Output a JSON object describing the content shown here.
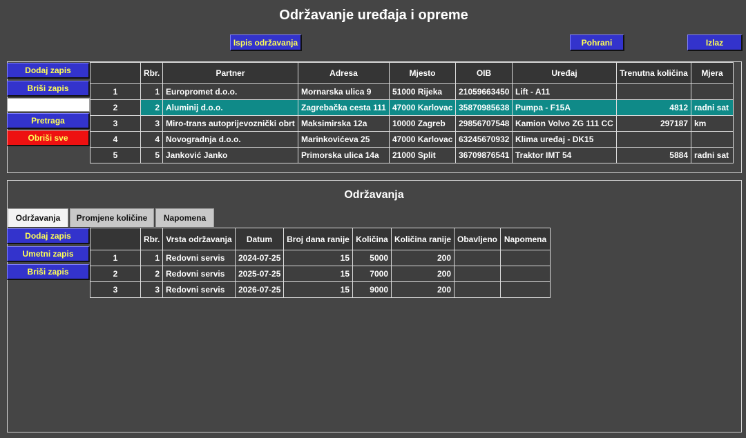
{
  "app": {
    "title": "Održavanje uređaja i opreme"
  },
  "toolbar": {
    "print_label": "Ispis održavanja",
    "save_label": "Pohrani",
    "exit_label": "Izlaz"
  },
  "devices": {
    "actions": {
      "add": "Dodaj zapis",
      "delete": "Briši zapis",
      "search_value": "",
      "search": "Pretraga",
      "clear_all": "Obriši sve"
    },
    "columns": [
      "Rbr.",
      "Partner",
      "Adresa",
      "Mjesto",
      "OIB",
      "Uređaj",
      "Trenutna količina",
      "Mjera"
    ],
    "rows": [
      {
        "idx": "1",
        "rbr": "1",
        "partner": "Europromet d.o.o.",
        "adresa": "Mornarska ulica 9",
        "mjesto": "51000 Rijeka",
        "oib": "21059663450",
        "uredaj": "Lift - A11",
        "kolicina": "",
        "mjera": ""
      },
      {
        "idx": "2",
        "rbr": "2",
        "partner": "Aluminij d.o.o.",
        "adresa": "Zagrebačka cesta 111",
        "mjesto": "47000 Karlovac",
        "oib": "35870985638",
        "uredaj": "Pumpa - F15A",
        "kolicina": "4812",
        "mjera": "radni sat"
      },
      {
        "idx": "3",
        "rbr": "3",
        "partner": "Miro-trans autoprijevoznički obrt",
        "adresa": "Maksimirska 12a",
        "mjesto": "10000 Zagreb",
        "oib": "29856707548",
        "uredaj": "Kamion Volvo ZG 111 CC",
        "kolicina": "297187",
        "mjera": "km"
      },
      {
        "idx": "4",
        "rbr": "4",
        "partner": "Novogradnja d.o.o.",
        "adresa": "Marinkovićeva 25",
        "mjesto": "47000 Karlovac",
        "oib": "63245670932",
        "uredaj": "Klima uređaj - DK15",
        "kolicina": "",
        "mjera": ""
      },
      {
        "idx": "5",
        "rbr": "5",
        "partner": "Janković Janko",
        "adresa": "Primorska ulica 14a",
        "mjesto": "21000 Split",
        "oib": "36709876541",
        "uredaj": "Traktor IMT 54",
        "kolicina": "5884",
        "mjera": "radni sat"
      }
    ],
    "selected_row": 1,
    "selected_color": "#0f8a88"
  },
  "maintenance": {
    "title": "Održavanja",
    "tabs": [
      "Održavanja",
      "Promjene količine",
      "Napomena"
    ],
    "active_tab": 0,
    "actions": {
      "add": "Dodaj zapis",
      "insert": "Umetni zapis",
      "delete": "Briši zapis"
    },
    "columns": [
      "Rbr.",
      "Vrsta održavanja",
      "Datum",
      "Broj dana ranije",
      "Količina",
      "Količina ranije",
      "Obavljeno",
      "Napomena"
    ],
    "rows": [
      {
        "idx": "1",
        "rbr": "1",
        "vrsta": "Redovni servis",
        "datum": "2024-07-25",
        "dana": "15",
        "kolicina": "5000",
        "ranije": "200",
        "obavljeno": "",
        "napomena": ""
      },
      {
        "idx": "2",
        "rbr": "2",
        "vrsta": "Redovni servis",
        "datum": "2025-07-25",
        "dana": "15",
        "kolicina": "7000",
        "ranije": "200",
        "obavljeno": "",
        "napomena": ""
      },
      {
        "idx": "3",
        "rbr": "3",
        "vrsta": "Redovni servis",
        "datum": "2026-07-25",
        "dana": "15",
        "kolicina": "9000",
        "ranije": "200",
        "obavljeno": "",
        "napomena": ""
      }
    ]
  },
  "colors": {
    "background": "#454545",
    "button": "#3333cc",
    "button_text": "#ffff55",
    "danger_button": "#ee1111"
  }
}
